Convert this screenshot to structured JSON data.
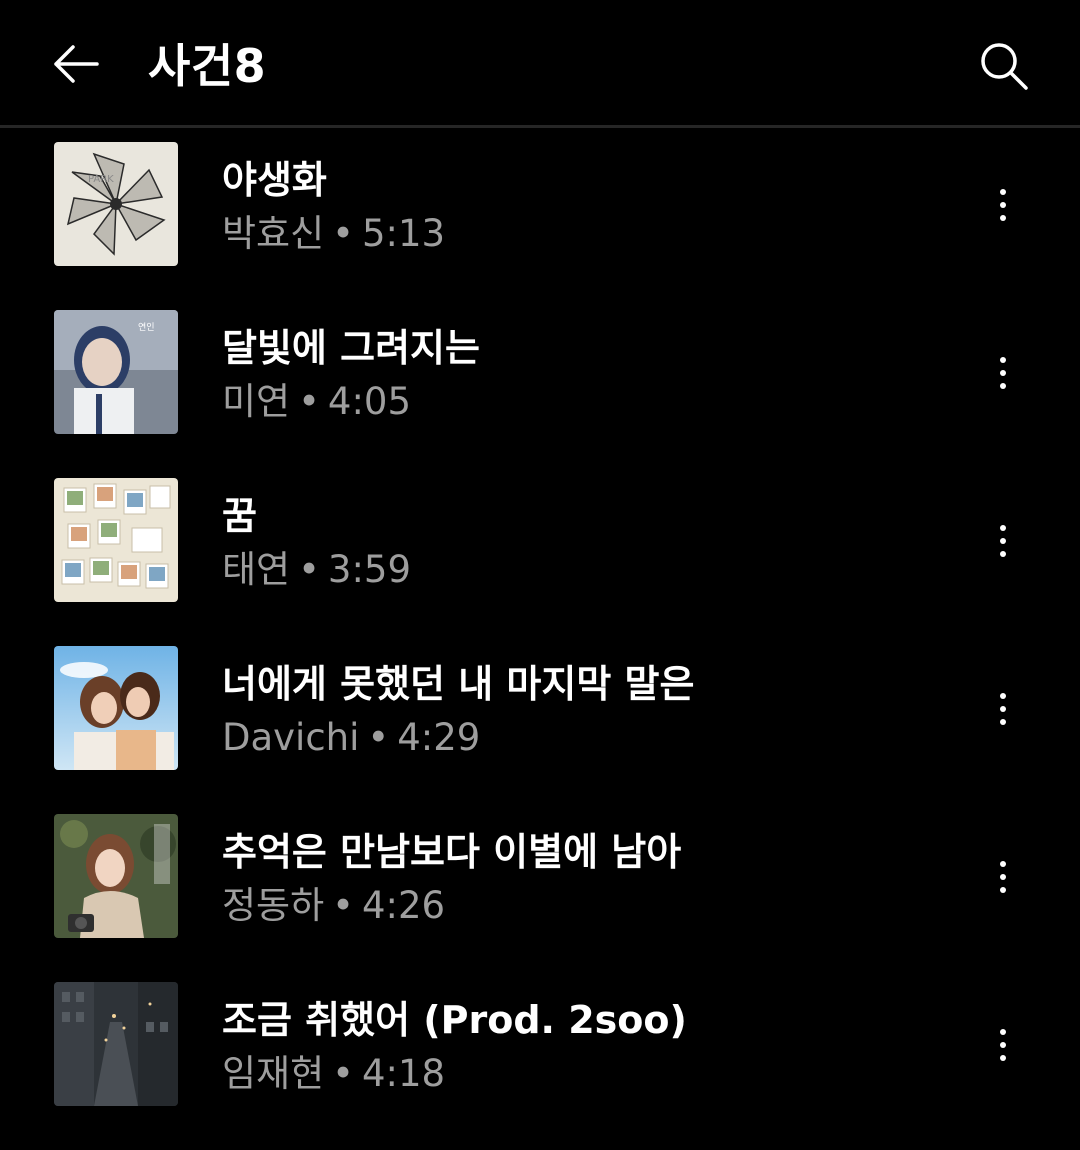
{
  "header": {
    "title": "사건8",
    "back_icon": "arrow-left-icon",
    "search_icon": "search-icon"
  },
  "songs": [
    {
      "title": "야생화",
      "artist": "박효신",
      "separator": "•",
      "duration": "5:13"
    },
    {
      "title": "달빛에 그려지는",
      "artist": "미연",
      "separator": "•",
      "duration": "4:05"
    },
    {
      "title": "꿈",
      "artist": "태연",
      "separator": "•",
      "duration": "3:59"
    },
    {
      "title": "너에게 못했던 내 마지막 말은",
      "artist": "Davichi",
      "separator": "•",
      "duration": "4:29"
    },
    {
      "title": "추억은 만남보다 이별에 남아",
      "artist": "정동하",
      "separator": "•",
      "duration": "4:26"
    },
    {
      "title": "조금 취했어 (Prod. 2soo)",
      "artist": "임재현",
      "separator": "•",
      "duration": "4:18"
    }
  ],
  "colors": {
    "background": "#000000",
    "primary_text": "#ffffff",
    "secondary_text": "#9e9e9e",
    "divider": "#262626"
  }
}
